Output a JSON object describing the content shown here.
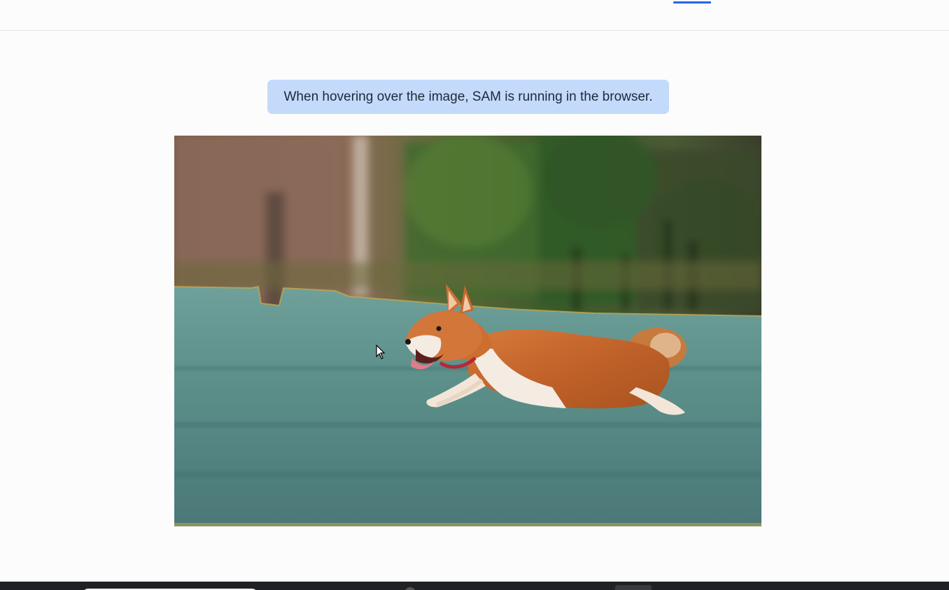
{
  "nav": {
    "items": [
      {
        "label": "",
        "active": true
      },
      {
        "label": "",
        "active": false
      },
      {
        "label": "",
        "active": false
      }
    ],
    "accent_color": "#2563eb"
  },
  "banner": {
    "text": "When hovering over the image, SAM is running in the browser.",
    "background": "#c3dafb"
  },
  "image": {
    "subject": "running corgi dog on grass",
    "segmentation_mask_color": "#5f9ea0"
  },
  "cursor": {
    "icon": "arrow-pointer-icon"
  }
}
